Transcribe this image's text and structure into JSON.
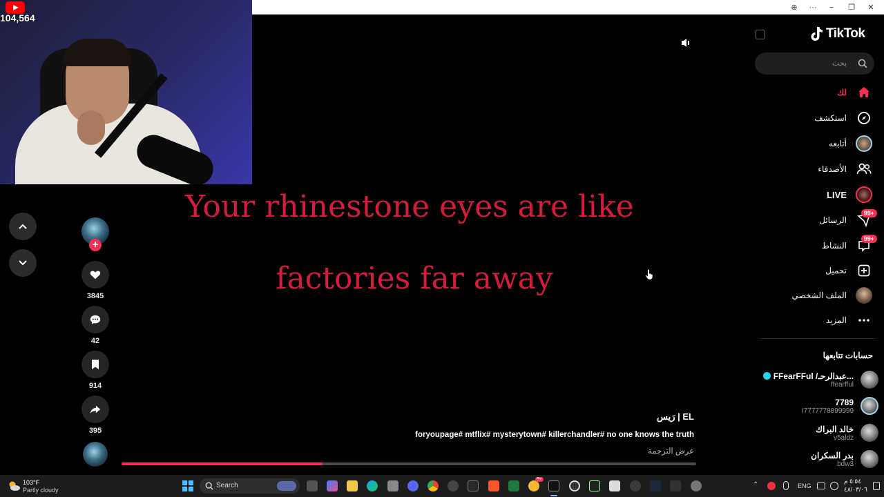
{
  "stream": {
    "viewer_count": "104,564"
  },
  "titlebar": {
    "zoom": "⊕",
    "more": "···",
    "minimize": "−",
    "maximize": "❐",
    "close": "✕"
  },
  "video": {
    "lyrics": [
      "Your rhinestone eyes are like",
      "factories far away"
    ],
    "progress": 0.35
  },
  "actions": {
    "likes": "3845",
    "comments": "42",
    "bookmarks": "914",
    "shares": "395"
  },
  "caption": {
    "author": "EL | رَيس",
    "text": "foryoupage# mtflix# mysterytown# killerchandler# no one knows the truth",
    "translate": "عرض الترجمة"
  },
  "sidebar": {
    "brand": "TikTok",
    "search_placeholder": "بحث",
    "nav": [
      {
        "label": "لك",
        "icon": "home-icon",
        "active": true
      },
      {
        "label": "استكشف",
        "icon": "compass-icon"
      },
      {
        "label": "أتابعه",
        "icon": "following-avatar-icon"
      },
      {
        "label": "الأصدقاء",
        "icon": "friends-icon"
      },
      {
        "label": "LIVE",
        "icon": "live-icon"
      },
      {
        "label": "الرسائل",
        "icon": "messages-icon",
        "badge": "+99"
      },
      {
        "label": "النشاط",
        "icon": "activity-icon",
        "badge": "+99"
      },
      {
        "label": "تحميل",
        "icon": "upload-icon"
      },
      {
        "label": "الملف الشخصي",
        "icon": "profile-avatar-icon"
      },
      {
        "label": "المزيد",
        "icon": "more-icon"
      }
    ],
    "following_heading": "حسابات تتابعها",
    "following": [
      {
        "name": "FFearFFul /عبدالرحـ...",
        "handle": "ffearfful",
        "verified": true
      },
      {
        "name": "7789",
        "handle": "I7777778899999"
      },
      {
        "name": "خالد البراك",
        "handle": "v5aldz"
      },
      {
        "name": "بدر السكران",
        "handle": "bdw3"
      }
    ]
  },
  "taskbar": {
    "weather_temp": "103°F",
    "weather_desc": "Partly cloudy",
    "search_label": "Search",
    "language": "ENG",
    "time": "٥:٥٤ م",
    "date": "٤٨/٠٣/٠٦",
    "app_badge": "9+"
  },
  "colors": {
    "accent": "#fe2c55",
    "lyric": "#d41c3c"
  }
}
